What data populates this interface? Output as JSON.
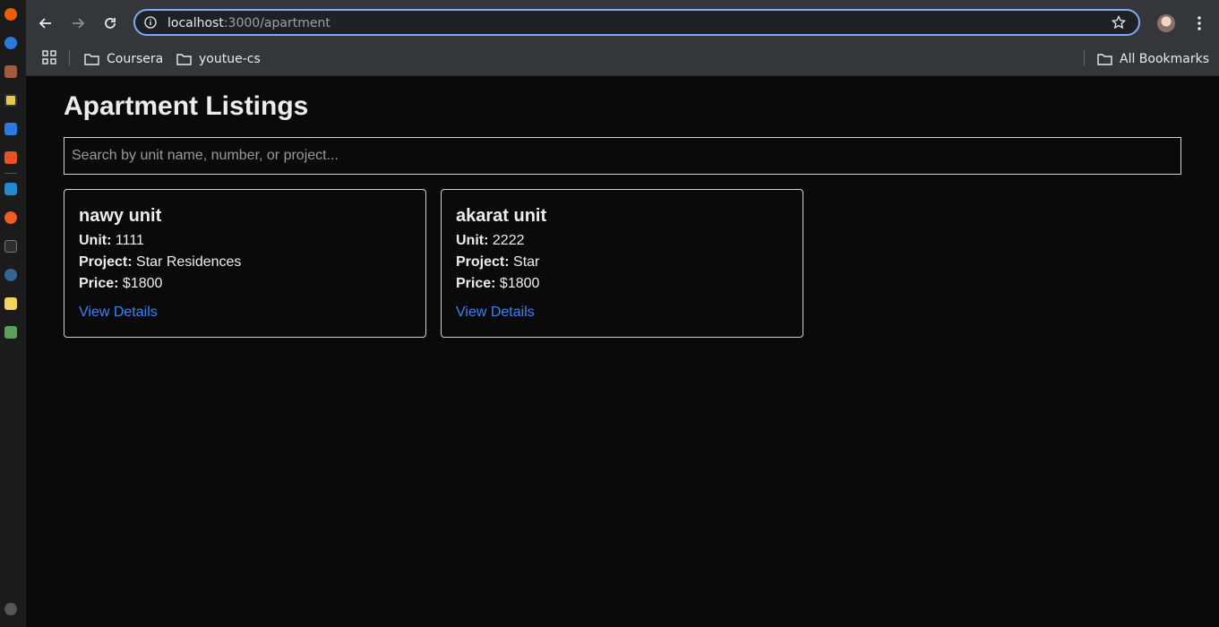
{
  "browser": {
    "url_host": "localhost",
    "url_path": ":3000/apartment",
    "bookmarks": [
      {
        "label": "Coursera"
      },
      {
        "label": "youtue-cs"
      }
    ],
    "all_bookmarks_label": "All Bookmarks"
  },
  "page": {
    "title": "Apartment Listings",
    "search_placeholder": "Search by unit name, number, or project...",
    "labels": {
      "unit": "Unit:",
      "project": "Project:",
      "price": "Price:"
    },
    "link_label": "View Details",
    "listings": [
      {
        "name": "nawy unit",
        "unit": "1111",
        "project": "Star Residences",
        "price": "$1800"
      },
      {
        "name": "akarat unit",
        "unit": "2222",
        "project": "Star",
        "price": "$1800"
      }
    ]
  },
  "dock": {
    "icons": [
      "firefox-icon",
      "thunderbird-icon",
      "files-icon",
      "rhythmbox-icon",
      "writer-icon",
      "software-icon",
      "vscode-icon",
      "postman-icon",
      "terminal-icon",
      "pgadmin-icon",
      "notes-icon",
      "trash-icon",
      "apps-grid-icon"
    ]
  }
}
